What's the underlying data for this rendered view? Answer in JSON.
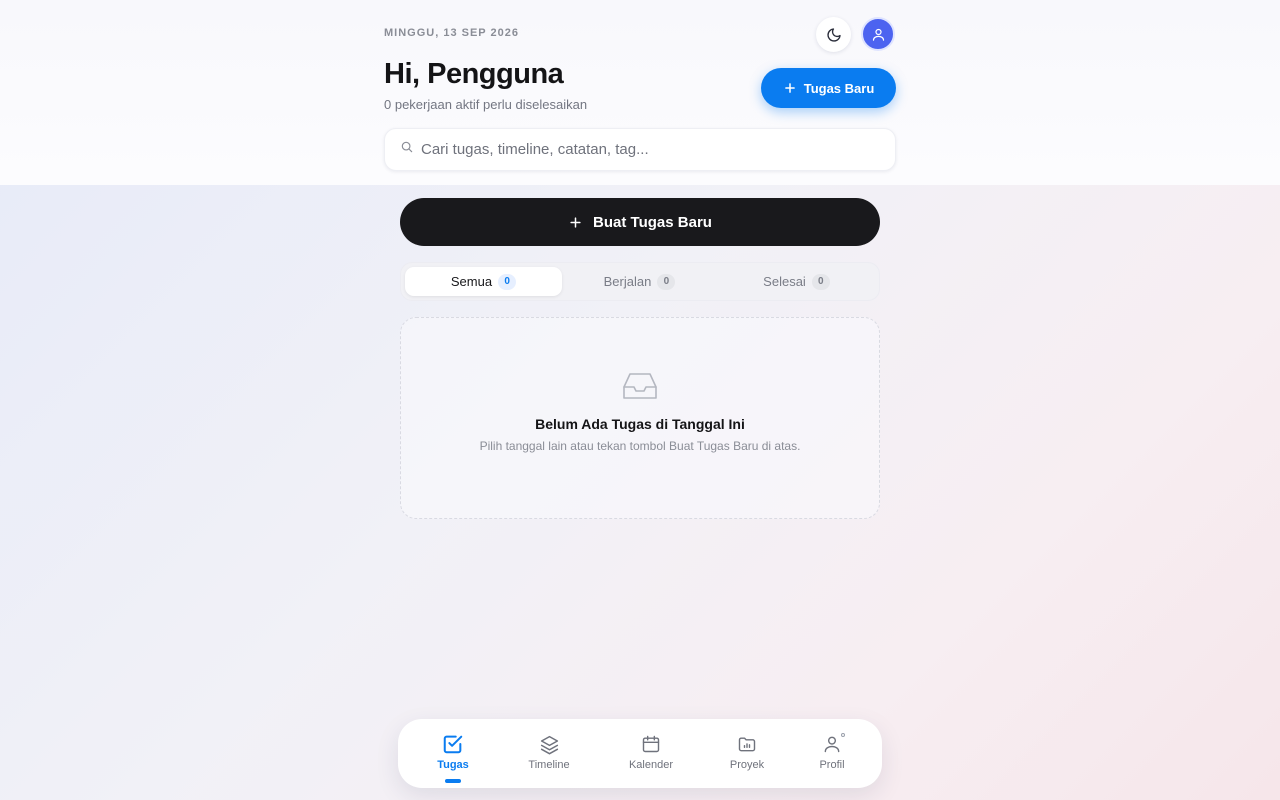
{
  "header": {
    "date": "MINGGU, 13 SEP 2026",
    "greeting": "Hi, Pengguna",
    "subtitle": "0 pekerjaan aktif perlu diselesaikan",
    "new_task_label": "Tugas Baru",
    "theme_icon": "moon-icon",
    "avatar_icon": "user-icon"
  },
  "search": {
    "placeholder": "Cari tugas, timeline, catatan, tag...",
    "value": ""
  },
  "create_button": {
    "label": "Buat Tugas Baru"
  },
  "tabs": [
    {
      "label": "Semua",
      "count": "0",
      "active": true
    },
    {
      "label": "Berjalan",
      "count": "0",
      "active": false
    },
    {
      "label": "Selesai",
      "count": "0",
      "active": false
    }
  ],
  "empty_state": {
    "icon": "inbox-icon",
    "title": "Belum Ada Tugas di Tanggal Ini",
    "description": "Pilih tanggal lain atau tekan tombol Buat Tugas Baru di atas."
  },
  "bottom_nav": [
    {
      "label": "Tugas",
      "icon": "check-square-icon",
      "active": true
    },
    {
      "label": "Timeline",
      "icon": "layers-icon",
      "active": false
    },
    {
      "label": "Kalender",
      "icon": "calendar-icon",
      "active": false
    },
    {
      "label": "Proyek",
      "icon": "folder-icon",
      "active": false
    },
    {
      "label": "Profil",
      "icon": "user-icon",
      "active": false
    }
  ],
  "colors": {
    "accent": "#0a7cf0",
    "avatar": "#4c63f0",
    "dark_button": "#19191c"
  }
}
